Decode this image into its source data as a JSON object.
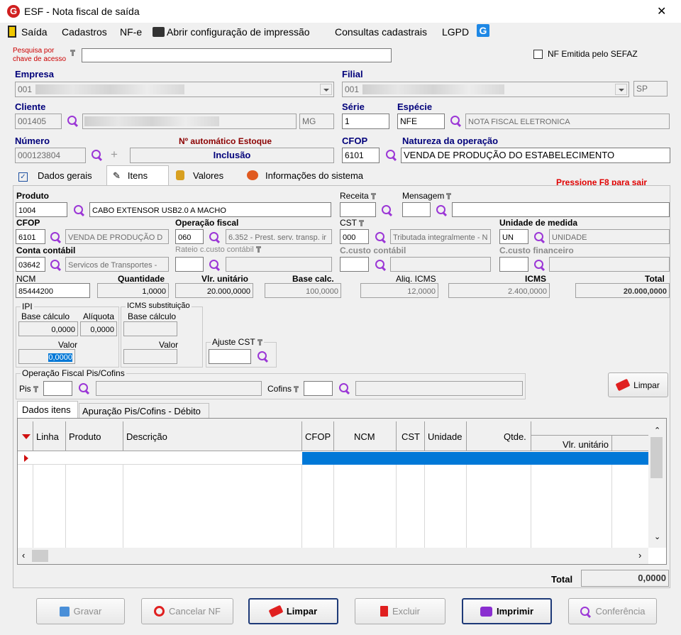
{
  "window": {
    "title": "ESF - Nota fiscal de saída",
    "close": "✕"
  },
  "menu": [
    "Saída",
    "Cadastros",
    "NF-e",
    "Abrir configuração de impressão",
    "Consultas cadastrais",
    "LGPD"
  ],
  "search": {
    "label1": "Pesquisa por",
    "label2": "chave de acesso",
    "value": "",
    "sefaz": "NF Emitida pelo SEFAZ"
  },
  "empresa": {
    "label": "Empresa",
    "value": "001"
  },
  "filial": {
    "label": "Filial",
    "value": "001",
    "uf": "SP"
  },
  "cliente": {
    "label": "Cliente",
    "code": "001405",
    "uf": "MG"
  },
  "serie": {
    "label": "Série",
    "value": "1"
  },
  "especie": {
    "label": "Espécie",
    "code": "NFE",
    "desc": "NOTA FISCAL ELETRONICA"
  },
  "numero": {
    "label": "Número",
    "value": "000123804",
    "auto_label": "Nº automático Estoque",
    "mode": "Inclusão"
  },
  "cfop": {
    "label": "CFOP",
    "value": "6101"
  },
  "natureza": {
    "label": "Natureza da operação",
    "value": "VENDA DE PRODUÇÃO DO ESTABELECIMENTO"
  },
  "tabs": [
    "Dados gerais",
    "Itens",
    "Valores",
    "Informações do sistema"
  ],
  "hint": "Pressione F8 para sair",
  "item": {
    "produto_label": "Produto",
    "produto_code": "1004",
    "produto_desc": "CABO EXTENSOR USB2.0 A MACHO",
    "receita_label": "Receita",
    "mensagem_label": "Mensagem",
    "cfop_label": "CFOP",
    "cfop_code": "6101",
    "cfop_desc": "VENDA DE PRODUÇÃO D",
    "opfiscal_label": "Operação fiscal",
    "opfiscal_code": "060",
    "opfiscal_desc": "6.352 - Prest. serv. transp. ir",
    "cst_label": "CST",
    "cst_code": "000",
    "cst_desc": "Tributada integralmente - N",
    "unidade_label": "Unidade de medida",
    "unidade_code": "UN",
    "unidade_desc": "UNIDADE",
    "conta_label": "Conta contábil",
    "conta_code": "03642",
    "conta_desc": "Servicos de Transportes -",
    "rateio_label": "Rateio c.custo contábil",
    "ccusto_label": "C.custo contábil",
    "ccfin_label": "C.custo financeiro",
    "ncm_label": "NCM",
    "ncm": "85444200",
    "qtd_label": "Quantidade",
    "qtd": "1,0000",
    "vunit_label": "Vlr. unitário",
    "vunit": "20.000,0000",
    "base_label": "Base calc.",
    "base": "100,0000",
    "aliq_label": "Aliq. ICMS",
    "aliq": "12,0000",
    "icms_label": "ICMS",
    "icms": "2.400,0000",
    "total_label": "Total",
    "total": "20.000,0000"
  },
  "ipi": {
    "title": "IPI",
    "base_label": "Base cálculo",
    "aliq_label": "Alíquota",
    "base": "0,0000",
    "aliq": "0,0000",
    "valor_label": "Valor",
    "valor": "0,0000"
  },
  "icmsst": {
    "title": "ICMS substituição",
    "base_label": "Base cálculo",
    "valor_label": "Valor"
  },
  "ajuste": {
    "label": "Ajuste CST"
  },
  "piscofins": {
    "title": "Operação Fiscal Pis/Cofins",
    "pis_label": "Pis",
    "cofins_label": "Cofins"
  },
  "limpar_small": "Limpar",
  "subtabs": [
    "Dados itens",
    "Apuração Pis/Cofins - Débito"
  ],
  "grid": {
    "headers": [
      "Linha",
      "Produto",
      "Descrição",
      "CFOP",
      "NCM",
      "CST",
      "Unidade",
      "Qtde.",
      "Vlr. unitário"
    ]
  },
  "total": {
    "label": "Total",
    "value": "0,0000"
  },
  "buttons": {
    "gravar": "Gravar",
    "cancelar": "Cancelar NF",
    "limpar": "Limpar",
    "excluir": "Excluir",
    "imprimir": "Imprimir",
    "conferencia": "Conferência"
  },
  "colors": {
    "accent": "#0078d7",
    "red_label": "#cc0000",
    "highlight": "#0078d7"
  }
}
